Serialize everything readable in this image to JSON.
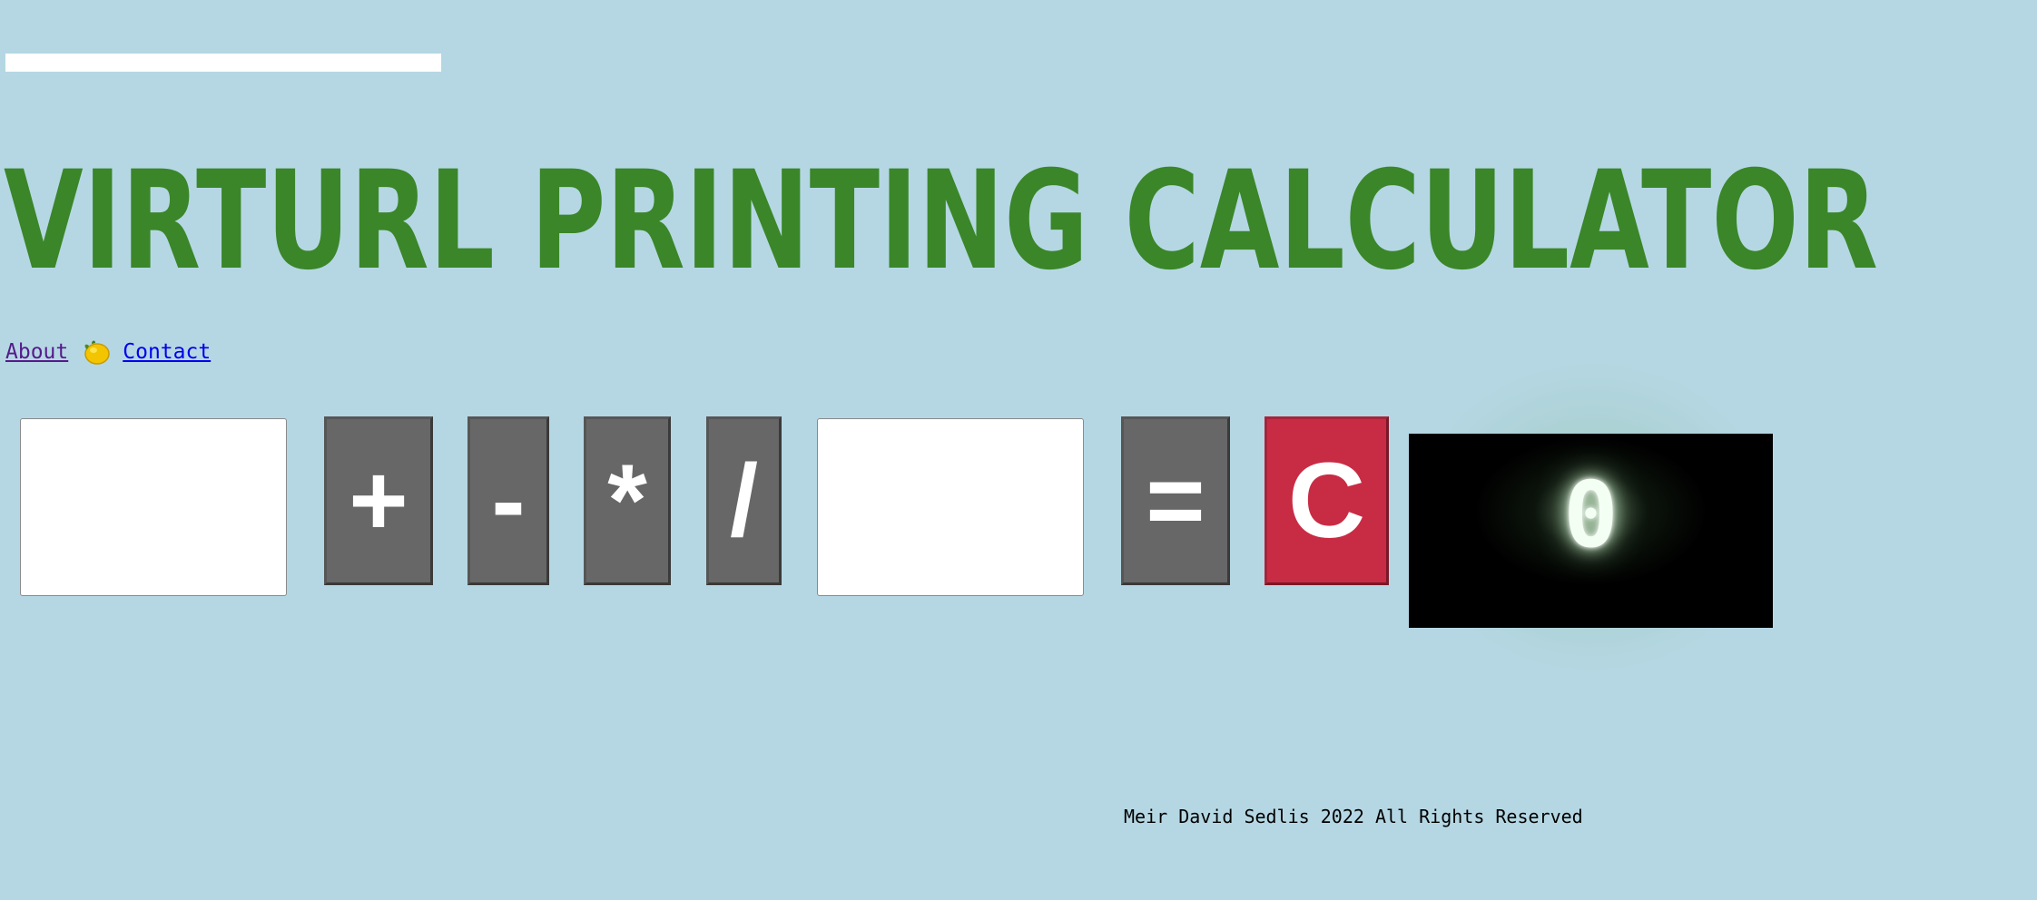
{
  "header": {
    "title": "VIRTURL PRINTING CALCULATOR"
  },
  "nav": {
    "about_label": "About",
    "contact_label": "Contact",
    "lemon_icon": "lemon-icon"
  },
  "calculator": {
    "first_value": "",
    "second_value": "",
    "operators": {
      "plus": "+",
      "minus": "-",
      "multiply": "*",
      "divide": "/"
    },
    "equals_label": "=",
    "clear_label": "C",
    "display_value": "0",
    "colors": {
      "background": "#b5d7e3",
      "title": "#3a8629",
      "operator_button": "#676767",
      "clear_button": "#c82c44",
      "display_bg": "#000000"
    }
  },
  "footer": {
    "text": "Meir David Sedlis 2022 All Rights Reserved"
  }
}
